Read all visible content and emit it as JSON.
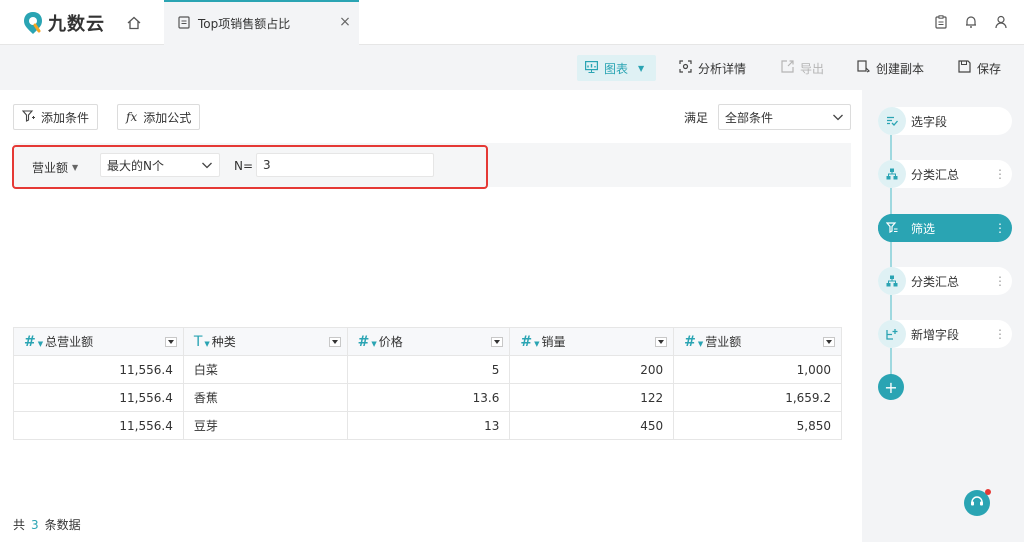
{
  "app": {
    "logo_text": "九数云"
  },
  "tab": {
    "title": "Top项销售额占比"
  },
  "toolbar": {
    "chart": "图表",
    "analysis": "分析详情",
    "export": "导出",
    "copy": "创建副本",
    "save": "保存"
  },
  "filter": {
    "add_condition": "添加条件",
    "add_formula": "添加公式",
    "satisfy_label": "满足",
    "satisfy_value": "全部条件",
    "field": "营业额",
    "mode": "最大的N个",
    "n_label": "N=",
    "n_value": "3"
  },
  "table": {
    "columns": [
      {
        "type": "#",
        "name": "总营业额"
      },
      {
        "type": "T",
        "name": "种类"
      },
      {
        "type": "#",
        "name": "价格"
      },
      {
        "type": "#",
        "name": "销量"
      },
      {
        "type": "#",
        "name": "营业额"
      }
    ],
    "rows": [
      [
        "11,556.4",
        "白菜",
        "5",
        "200",
        "1,000"
      ],
      [
        "11,556.4",
        "香蕉",
        "13.6",
        "122",
        "1,659.2"
      ],
      [
        "11,556.4",
        "豆芽",
        "13",
        "450",
        "5,850"
      ]
    ]
  },
  "footer": {
    "prefix": "共",
    "count": "3",
    "suffix": "条数据"
  },
  "steps": [
    {
      "label": "选字段",
      "icon": "select-field-icon"
    },
    {
      "label": "分类汇总",
      "icon": "group-summary-icon"
    },
    {
      "label": "筛选",
      "icon": "filter-icon",
      "active": true
    },
    {
      "label": "分类汇总",
      "icon": "group-summary-icon"
    },
    {
      "label": "新增字段",
      "icon": "add-field-icon"
    }
  ],
  "colors": {
    "accent": "#2aa4b3",
    "highlight_border": "#e53935"
  }
}
